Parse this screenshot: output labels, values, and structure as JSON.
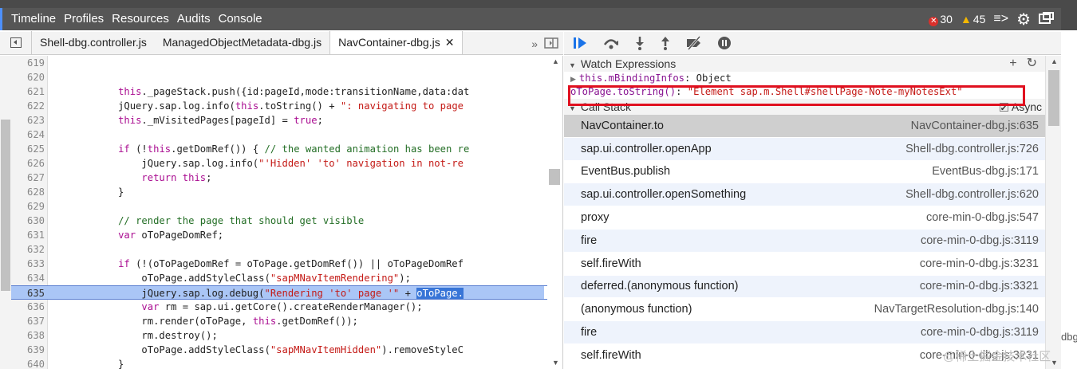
{
  "topbar": {
    "tabs": [
      "Timeline",
      "Profiles",
      "Resources",
      "Audits",
      "Console"
    ],
    "errors": "30",
    "warnings": "45"
  },
  "source": {
    "tabs": [
      "Shell-dbg.controller.js",
      "ManagedObjectMetadata-dbg.js",
      "NavContainer-dbg.js"
    ],
    "more": "»",
    "lines": [
      {
        "n": "619",
        "html": ""
      },
      {
        "n": "620",
        "html": ""
      },
      {
        "n": "621",
        "html": "            <span class=\"kw\">this</span>._pageStack.push({id:pageId,mode:transitionName,data:dat"
      },
      {
        "n": "622",
        "html": "            jQuery.sap.log.info(<span class=\"kw\">this</span>.toString() + <span class=\"str\">\": navigating to page</span>"
      },
      {
        "n": "623",
        "html": "            <span class=\"kw\">this</span>._mVisitedPages[pageId] = <span class=\"kw\">true</span>;"
      },
      {
        "n": "624",
        "html": ""
      },
      {
        "n": "625",
        "html": "            <span class=\"kw\">if</span> (!<span class=\"kw\">this</span>.getDomRef()) { <span class=\"cm\">// the wanted animation has been re</span>"
      },
      {
        "n": "626",
        "html": "                jQuery.sap.log.info(<span class=\"str\">\"'Hidden' 'to' navigation in not-re</span>"
      },
      {
        "n": "627",
        "html": "                <span class=\"kw\">return this</span>;"
      },
      {
        "n": "628",
        "html": "            }"
      },
      {
        "n": "629",
        "html": ""
      },
      {
        "n": "630",
        "html": "            <span class=\"cm\">// render the page that should get visible</span>"
      },
      {
        "n": "631",
        "html": "            <span class=\"kw\">var</span> oToPageDomRef;"
      },
      {
        "n": "632",
        "html": ""
      },
      {
        "n": "633",
        "html": "            <span class=\"kw\">if</span> (!(oToPageDomRef = oToPage.getDomRef()) || oToPageDomRef"
      },
      {
        "n": "634",
        "html": "                oToPage.addStyleClass(<span class=\"str\">\"sapMNavItemRendering\"</span>);"
      },
      {
        "n": "635",
        "html": "                jQuery.sap.log.debug(<span class=\"str\">\"Rendering 'to' page '\"</span> + <span class=\"sel\">oToPage.</span>"
      },
      {
        "n": "636",
        "html": "                <span class=\"kw\">var</span> rm = sap.ui.getCore().createRenderManager();"
      },
      {
        "n": "637",
        "html": "                rm.render(oToPage, <span class=\"kw\">this</span>.getDomRef());"
      },
      {
        "n": "638",
        "html": "                rm.destroy();"
      },
      {
        "n": "639",
        "html": "                oToPage.addStyleClass(<span class=\"str\">\"sapMNavItemHidden\"</span>).removeStyleC"
      },
      {
        "n": "640",
        "html": "            }"
      }
    ],
    "highlight_line": "635"
  },
  "watch": {
    "title": "Watch Expressions",
    "row1_expr": "this.mBindingInfos",
    "row1_value": ": Object",
    "row2_expr": "oToPage.toString()",
    "row2_sep": ": ",
    "row2_value": "\"Element sap.m.Shell#shellPage-Note-myNotesExt\""
  },
  "callstack": {
    "title": "Call Stack",
    "async_label": "Async",
    "frames": [
      {
        "fn": "NavContainer.to",
        "loc": "NavContainer-dbg.js:635"
      },
      {
        "fn": "sap.ui.controller.openApp",
        "loc": "Shell-dbg.controller.js:726"
      },
      {
        "fn": "EventBus.publish",
        "loc": "EventBus-dbg.js:171"
      },
      {
        "fn": "sap.ui.controller.openSomething",
        "loc": "Shell-dbg.controller.js:620"
      },
      {
        "fn": "proxy",
        "loc": "core-min-0-dbg.js:547"
      },
      {
        "fn": "fire",
        "loc": "core-min-0-dbg.js:3119"
      },
      {
        "fn": "self.fireWith",
        "loc": "core-min-0-dbg.js:3231"
      },
      {
        "fn": "deferred.(anonymous function)",
        "loc": "core-min-0-dbg.js:3321"
      },
      {
        "fn": "(anonymous function)",
        "loc": "NavTargetResolution-dbg.js:140"
      },
      {
        "fn": "fire",
        "loc": "core-min-0-dbg.js:3119"
      },
      {
        "fn": "self.fireWith",
        "loc": "core-min-0-dbg.js:3231"
      }
    ]
  },
  "edge_text": "dbg",
  "watermark": "@稀土掘金技术社区"
}
